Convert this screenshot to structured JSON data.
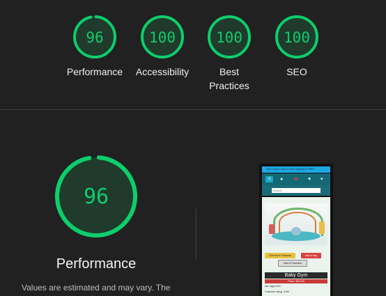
{
  "summary": {
    "gauges": [
      {
        "score": "96",
        "label": "Performance",
        "fraction": 0.96
      },
      {
        "score": "100",
        "label": "Accessibility",
        "fraction": 1.0
      },
      {
        "score": "100",
        "label": "Best Practices",
        "fraction": 1.0
      },
      {
        "score": "100",
        "label": "SEO",
        "fraction": 1.0
      }
    ]
  },
  "detail": {
    "score": "96",
    "fraction": 0.96,
    "title": "Performance",
    "note": "Values are estimated and may vary. The"
  },
  "colors": {
    "pass": "#0cce6b",
    "background": "#212121"
  },
  "preview": {
    "banner": "Your coupon code for free shipping is: FREE",
    "search_placeholder": "Search",
    "icons": [
      "menu-icon",
      "user-icon",
      "logo-icon",
      "heart-icon",
      "cart-icon"
    ],
    "find_more": "Find More Products",
    "add_to_bag": "Add to bag",
    "add_to_favorites": "Add to Favorites",
    "product_name": "Baby Gym",
    "price": "Price: $19.99",
    "sku_line": "sku: bgym-001",
    "rating_line": "Customer rating: 4.5/5"
  }
}
